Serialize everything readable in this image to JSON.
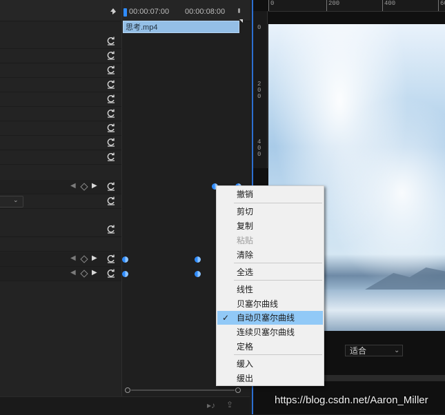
{
  "timeline": {
    "timecodes": [
      "00:00:07:00",
      "00:00:08:00"
    ],
    "clip_name": "思考.mp4"
  },
  "monitor": {
    "ruler_top": [
      "0",
      "200",
      "400",
      "60"
    ],
    "ruler_left": [
      "0",
      "2\n0\n0",
      "4\n0\n0"
    ],
    "fit_label": "适合"
  },
  "context_menu": {
    "items": [
      {
        "label": "撤销",
        "state": "normal"
      },
      {
        "label": "剪切",
        "state": "normal"
      },
      {
        "label": "复制",
        "state": "normal"
      },
      {
        "label": "粘贴",
        "state": "disabled"
      },
      {
        "label": "清除",
        "state": "normal"
      },
      {
        "label": "全选",
        "state": "normal"
      },
      {
        "label": "线性",
        "state": "normal"
      },
      {
        "label": "贝塞尔曲线",
        "state": "normal"
      },
      {
        "label": "自动贝塞尔曲线",
        "state": "checked"
      },
      {
        "label": "连续贝塞尔曲线",
        "state": "normal"
      },
      {
        "label": "定格",
        "state": "normal"
      },
      {
        "label": "缓入",
        "state": "normal"
      },
      {
        "label": "缓出",
        "state": "normal"
      }
    ],
    "check_glyph": "✓"
  },
  "watermark": "https://blog.csdn.net/Aaron_Miller",
  "colors": {
    "accent_blue": "#2c6fd1",
    "clip": "#94bfe6",
    "menu_highlight": "#91c9f7"
  }
}
